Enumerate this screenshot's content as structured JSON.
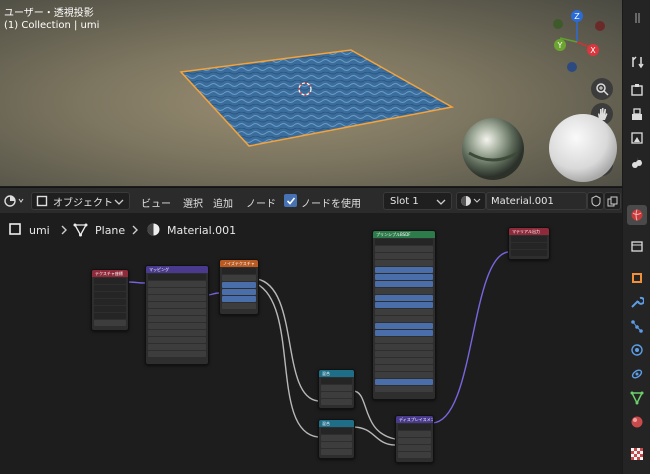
{
  "viewport": {
    "title": "ユーザー・透視投影",
    "subtitle": "(1) Collection | umi",
    "gizmo": {
      "z": "Z",
      "y": "Y",
      "x": "X"
    }
  },
  "header": {
    "mode": "オブジェクト",
    "menus": [
      "ビュー",
      "選択",
      "追加",
      "ノード"
    ],
    "use_nodes_label": "ノードを使用",
    "use_nodes_checked": true,
    "slot": "Slot 1",
    "material": "Material.001"
  },
  "breadcrumb": {
    "object": "umi",
    "mesh": "Plane",
    "material": "Material.001"
  },
  "nodes": {
    "texcoord": {
      "title": "テクスチャ座標"
    },
    "mapping": {
      "title": "マッピング"
    },
    "noise": {
      "title": "ノイズテクスチャ"
    },
    "bsdf": {
      "title": "プリンシプルBSDF"
    },
    "output": {
      "title": "マテリアル出力"
    },
    "mix1": {
      "title": "混合"
    },
    "mix2": {
      "title": "混合"
    },
    "displacement": {
      "title": "ディスプレイスメント"
    }
  },
  "colors": {
    "accent": "#4772b3",
    "selection": "#f5a33a",
    "water": "#3b6d9c",
    "link_gray": "#b8b8b8",
    "link_purple": "#7766e0",
    "link_green": "#78d26c"
  }
}
